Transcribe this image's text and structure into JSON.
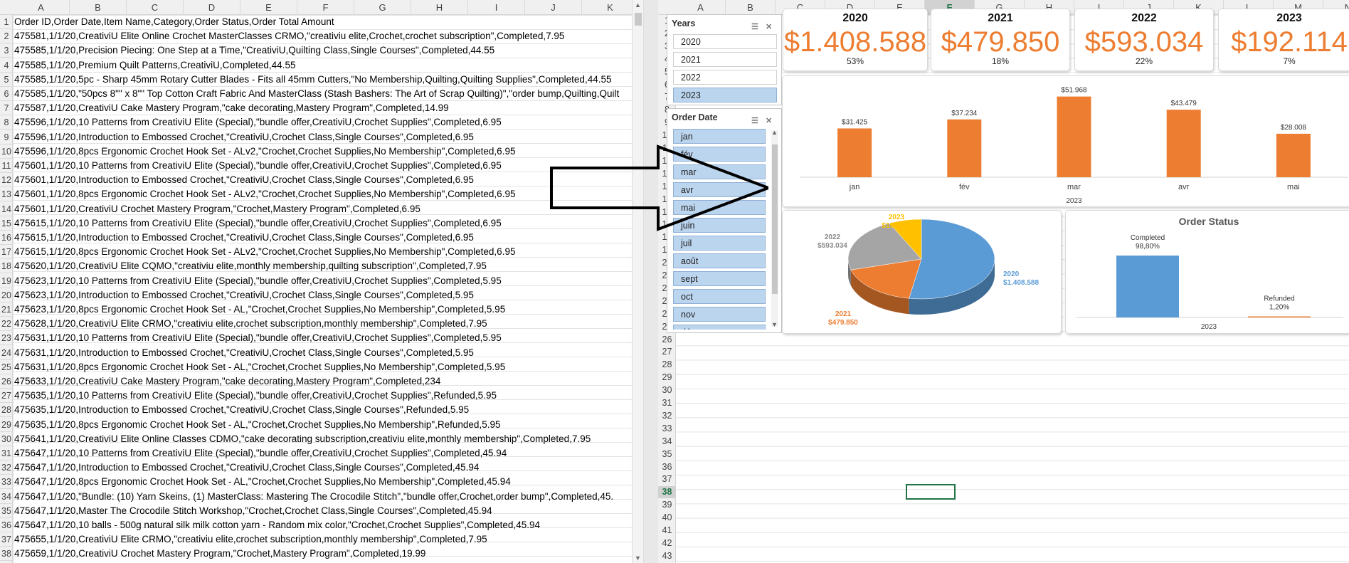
{
  "left_sheet": {
    "columns": [
      "A",
      "B",
      "C",
      "D",
      "E",
      "F",
      "G",
      "H",
      "I",
      "J",
      "K"
    ],
    "rows": [
      "Order ID,Order Date,Item Name,Category,Order Status,Order Total Amount",
      "475581,1/1/20,CreativiU Elite Online Crochet MasterClasses CRMO,\"creativiu elite,Crochet,crochet subscription\",Completed,7.95",
      "475585,1/1/20,Precision Piecing: One Step at a Time,\"CreativiU,Quilting Class,Single Courses\",Completed,44.55",
      "475585,1/1/20,Premium Quilt Patterns,CreativiU,Completed,44.55",
      "475585,1/1/20,5pc - Sharp 45mm Rotary Cutter Blades -  Fits all 45mm Cutters,\"No Membership,Quilting,Quilting Supplies\",Completed,44.55",
      "475585,1/1/20,\"50pcs 8\"\" x 8\"\" Top Cotton Craft Fabric And MasterClass (Stash Bashers: The Art of Scrap Quilting)\",\"order bump,Quilting,Quilt",
      "475587,1/1/20,CreativiU Cake Mastery Program,\"cake decorating,Mastery Program\",Completed,14.99",
      "475596,1/1/20,10 Patterns from CreativiU Elite (Special),\"bundle offer,CreativiU,Crochet Supplies\",Completed,6.95",
      "475596,1/1/20,Introduction to Embossed Crochet,\"CreativiU,Crochet Class,Single Courses\",Completed,6.95",
      "475596,1/1/20,8pcs Ergonomic Crochet Hook Set - ALv2,\"Crochet,Crochet Supplies,No Membership\",Completed,6.95",
      "475601,1/1/20,10 Patterns from CreativiU Elite (Special),\"bundle offer,CreativiU,Crochet Supplies\",Completed,6.95",
      "475601,1/1/20,Introduction to Embossed Crochet,\"CreativiU,Crochet Class,Single Courses\",Completed,6.95",
      "475601,1/1/20,8pcs Ergonomic Crochet Hook Set - ALv2,\"Crochet,Crochet Supplies,No Membership\",Completed,6.95",
      "475601,1/1/20,CreativiU Crochet Mastery Program,\"Crochet,Mastery Program\",Completed,6.95",
      "475615,1/1/20,10 Patterns from CreativiU Elite (Special),\"bundle offer,CreativiU,Crochet Supplies\",Completed,6.95",
      "475615,1/1/20,Introduction to Embossed Crochet,\"CreativiU,Crochet Class,Single Courses\",Completed,6.95",
      "475615,1/1/20,8pcs Ergonomic Crochet Hook Set - ALv2,\"Crochet,Crochet Supplies,No Membership\",Completed,6.95",
      "475620,1/1/20,CreativiU Elite CQMO,\"creativiu elite,monthly membership,quilting subscription\",Completed,7.95",
      "475623,1/1/20,10 Patterns from CreativiU Elite (Special),\"bundle offer,CreativiU,Crochet Supplies\",Completed,5.95",
      "475623,1/1/20,Introduction to Embossed Crochet,\"CreativiU,Crochet Class,Single Courses\",Completed,5.95",
      "475623,1/1/20,8pcs Ergonomic Crochet Hook Set - AL,\"Crochet,Crochet Supplies,No Membership\",Completed,5.95",
      "475628,1/1/20,CreativiU Elite CRMO,\"creativiu elite,crochet subscription,monthly membership\",Completed,7.95",
      "475631,1/1/20,10 Patterns from CreativiU Elite (Special),\"bundle offer,CreativiU,Crochet Supplies\",Completed,5.95",
      "475631,1/1/20,Introduction to Embossed Crochet,\"CreativiU,Crochet Class,Single Courses\",Completed,5.95",
      "475631,1/1/20,8pcs Ergonomic Crochet Hook Set - AL,\"Crochet,Crochet Supplies,No Membership\",Completed,5.95",
      "475633,1/1/20,CreativiU Cake Mastery Program,\"cake decorating,Mastery Program\",Completed,234",
      "475635,1/1/20,10 Patterns from CreativiU Elite (Special),\"bundle offer,CreativiU,Crochet Supplies\",Refunded,5.95",
      "475635,1/1/20,Introduction to Embossed Crochet,\"CreativiU,Crochet Class,Single Courses\",Refunded,5.95",
      "475635,1/1/20,8pcs Ergonomic Crochet Hook Set - AL,\"Crochet,Crochet Supplies,No Membership\",Refunded,5.95",
      "475641,1/1/20,CreativiU Elite Online Classes CDMO,\"cake decorating subscription,creativiu elite,monthly membership\",Completed,7.95",
      "475647,1/1/20,10 Patterns from CreativiU Elite (Special),\"bundle offer,CreativiU,Crochet Supplies\",Completed,45.94",
      "475647,1/1/20,Introduction to Embossed Crochet,\"CreativiU,Crochet Class,Single Courses\",Completed,45.94",
      "475647,1/1/20,8pcs Ergonomic Crochet Hook Set - AL,\"Crochet,Crochet Supplies,No Membership\",Completed,45.94",
      "475647,1/1/20,\"Bundle: (10) Yarn Skeins, (1) MasterClass: Mastering The Crocodile Stitch\",\"bundle offer,Crochet,order bump\",Completed,45.",
      "475647,1/1/20,Master The Crocodile Stitch Workshop,\"Crochet,Crochet Class,Single Courses\",Completed,45.94",
      "475647,1/1/20,10 balls - 500g natural silk milk cotton yarn - Random mix color,\"Crochet,Crochet Supplies\",Completed,45.94",
      "475655,1/1/20,CreativiU Elite CRMO,\"creativiu elite,crochet subscription,monthly membership\",Completed,7.95",
      "475659,1/1/20,CreativiU Crochet Mastery Program,\"Crochet,Mastery Program\",Completed,19.99",
      "475662,1/1/20,10 Patterns from CreativiU Elite (Special),\"bundle offer,CreativiU,Crochet Supplies\",Completed,5.95"
    ]
  },
  "right_sheet": {
    "columns": [
      "A",
      "B",
      "C",
      "D",
      "E",
      "F",
      "G",
      "H",
      "I",
      "J",
      "K",
      "L",
      "M",
      "N"
    ],
    "row_numbers": [
      "1",
      "2",
      "3",
      "4",
      "5",
      "6",
      "7",
      "8",
      "9",
      "10",
      "11",
      "12",
      "13",
      "14",
      "15",
      "16",
      "17",
      "18",
      "19",
      "20",
      "21",
      "22",
      "23",
      "24",
      "25",
      "26",
      "27",
      "28",
      "29",
      "30",
      "31",
      "32",
      "33",
      "34",
      "35",
      "36",
      "37",
      "38",
      "39",
      "40",
      "41",
      "42",
      "43"
    ]
  },
  "slicer_years": {
    "title": "Years",
    "items": [
      {
        "label": "2020",
        "selected": false
      },
      {
        "label": "2021",
        "selected": false
      },
      {
        "label": "2022",
        "selected": false
      },
      {
        "label": "2023",
        "selected": true
      }
    ]
  },
  "slicer_dates": {
    "title": "Order Date",
    "items": [
      "jan",
      "fév",
      "mar",
      "avr",
      "mai",
      "juin",
      "juil",
      "août",
      "sept",
      "oct",
      "nov",
      "déc"
    ]
  },
  "kpis": [
    {
      "year": "2020",
      "amount": "$1.408.588",
      "pct": "53%"
    },
    {
      "year": "2021",
      "amount": "$479.850",
      "pct": "18%"
    },
    {
      "year": "2022",
      "amount": "$593.034",
      "pct": "22%"
    },
    {
      "year": "2023",
      "amount": "$192.114",
      "pct": "7%"
    }
  ],
  "chart_data": [
    {
      "type": "bar",
      "categories": [
        "jan",
        "fév",
        "mar",
        "avr",
        "mai"
      ],
      "values": [
        31425,
        37234,
        51968,
        43479,
        28008
      ],
      "data_labels": [
        "$31.425",
        "$37.234",
        "$51.968",
        "$43.479",
        "$28.008"
      ],
      "group_label": "2023",
      "color": "#ed7d31"
    },
    {
      "type": "pie",
      "categories": [
        "2020",
        "2021",
        "2022",
        "2023"
      ],
      "values": [
        1408588,
        479850,
        593034,
        192114
      ],
      "labels": [
        "$1.408.588",
        "$479.850",
        "$593.034",
        "$192.114"
      ],
      "colors": [
        "#5b9bd5",
        "#ed7d31",
        "#a5a5a5",
        "#ffc000"
      ]
    },
    {
      "type": "bar",
      "title": "Order Status",
      "categories": [
        "Completed",
        "Refunded"
      ],
      "values": [
        98.8,
        1.2
      ],
      "data_labels": [
        "98,80%",
        "1,20%"
      ],
      "group_label": "2023",
      "colors": [
        "#5b9bd5",
        "#ed7d31"
      ]
    }
  ]
}
